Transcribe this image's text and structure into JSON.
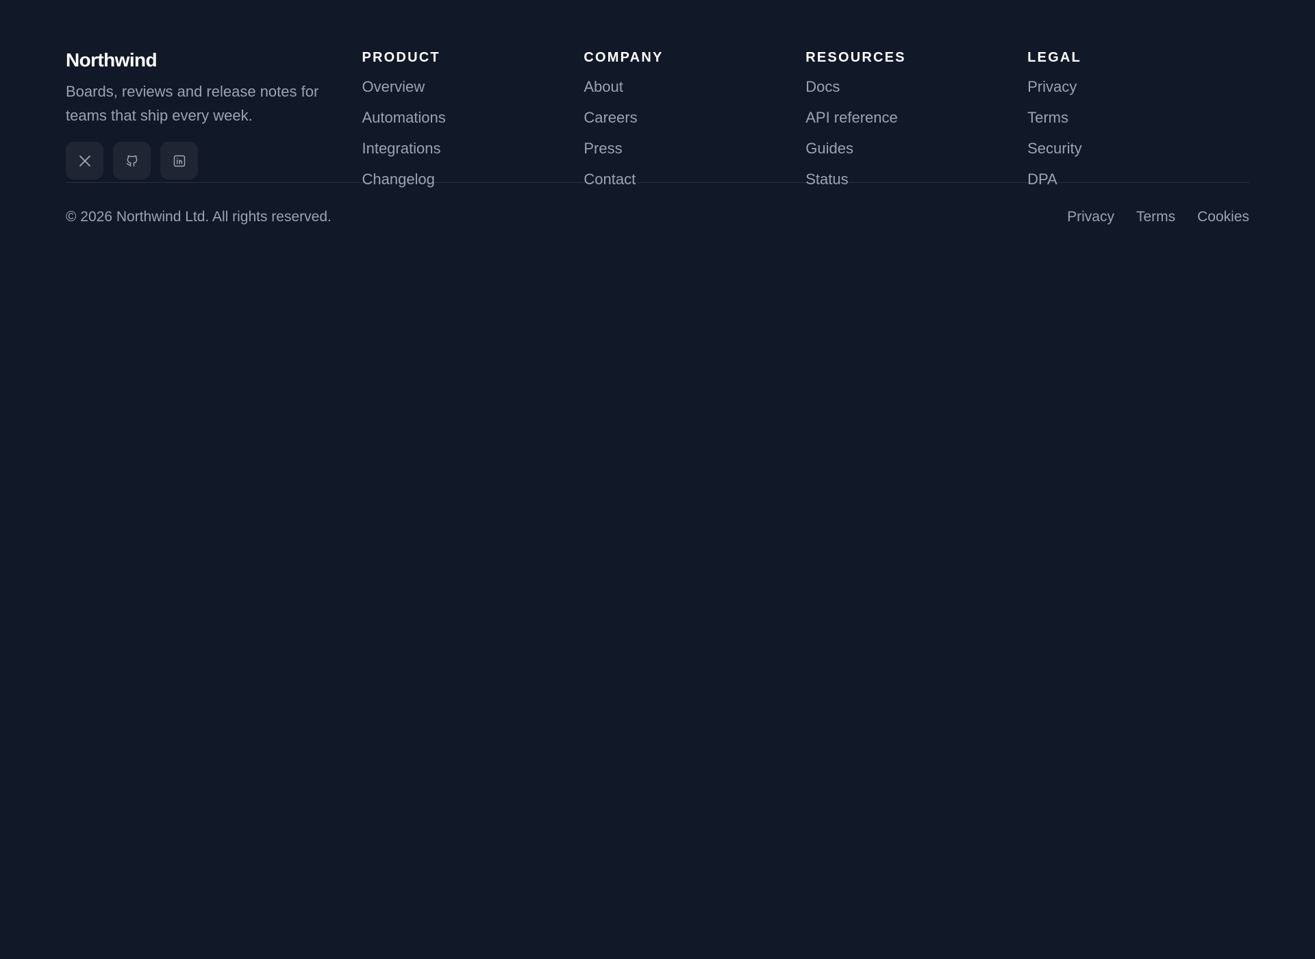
{
  "brand": {
    "name": "Northwind",
    "tagline": "Boards, reviews and release notes for teams that ship every week."
  },
  "socials": [
    {
      "icon": "x-icon",
      "label": "X"
    },
    {
      "icon": "github-icon",
      "label": "GitHub"
    },
    {
      "icon": "linkedin-icon",
      "label": "LinkedIn"
    }
  ],
  "columns": [
    {
      "heading": "PRODUCT",
      "links": [
        "Overview",
        "Automations",
        "Integrations",
        "Changelog"
      ]
    },
    {
      "heading": "COMPANY",
      "links": [
        "About",
        "Careers",
        "Press",
        "Contact"
      ]
    },
    {
      "heading": "RESOURCES",
      "links": [
        "Docs",
        "API reference",
        "Guides",
        "Status"
      ]
    },
    {
      "heading": "LEGAL",
      "links": [
        "Privacy",
        "Terms",
        "Security",
        "DPA"
      ]
    }
  ],
  "bottom": {
    "copyright": "© 2026 Northwind Ltd. All rights reserved.",
    "links": [
      "Privacy",
      "Terms",
      "Cookies"
    ]
  },
  "colors": {
    "background": "#111827",
    "text_muted": "#9ca3af",
    "heading": "#ffffff",
    "social_bg": "#1f2532",
    "divider": "#273043"
  }
}
